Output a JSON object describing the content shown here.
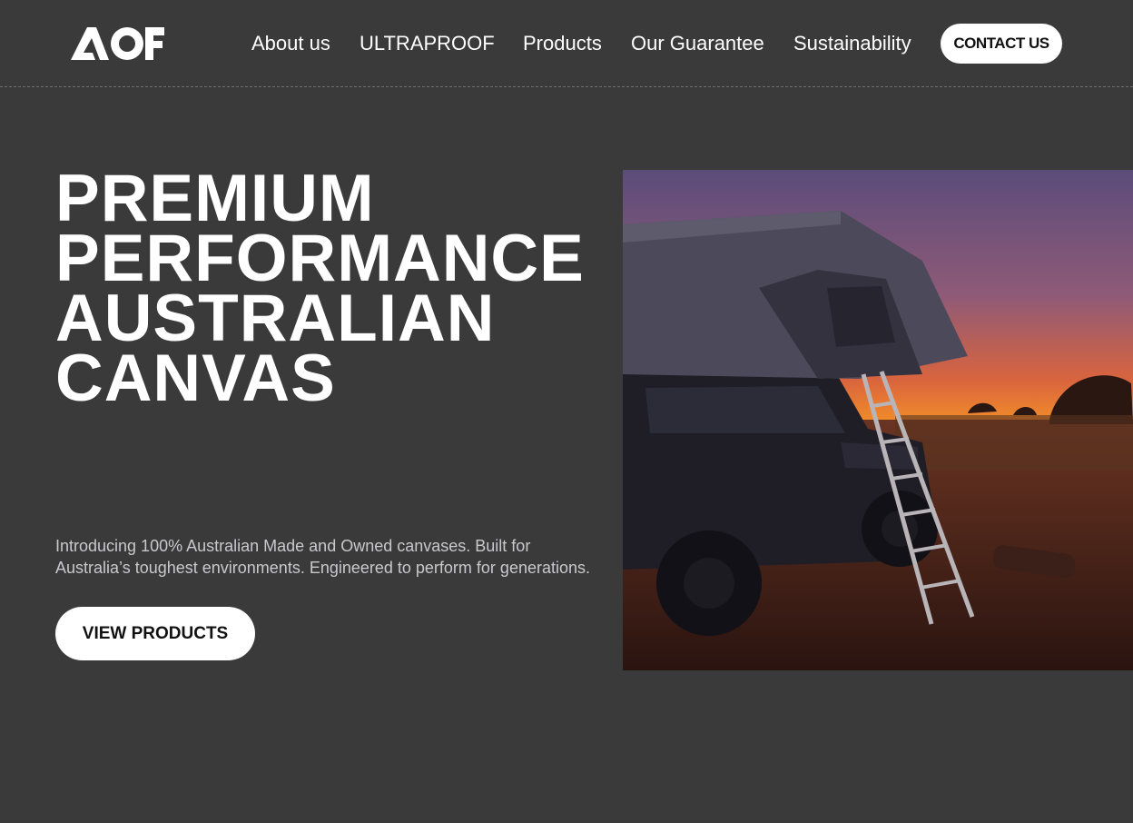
{
  "header": {
    "logo_text": "AOF",
    "nav": [
      {
        "label": "About us"
      },
      {
        "label": "ULTRAPROOF"
      },
      {
        "label": "Products"
      },
      {
        "label": "Our Guarantee"
      },
      {
        "label": "Sustainability"
      }
    ],
    "contact_label": "CONTACT US"
  },
  "hero": {
    "title_lines": [
      "PREMIUM",
      "PERFORMANCE",
      "AUSTRALIAN",
      "CANVAS"
    ],
    "description": "Introducing 100% Australian Made and Owned canvases. Built for Australia’s toughest environments. Engineered to perform for generations.",
    "cta_label": "VIEW PRODUCTS",
    "image_subject": "rooftop-tent-vehicle-sunset-photo"
  },
  "colors": {
    "background": "#3a3a3b",
    "text": "#ffffff",
    "muted_text": "#c9c9cb",
    "button_bg": "#ffffff",
    "button_text": "#111111"
  }
}
